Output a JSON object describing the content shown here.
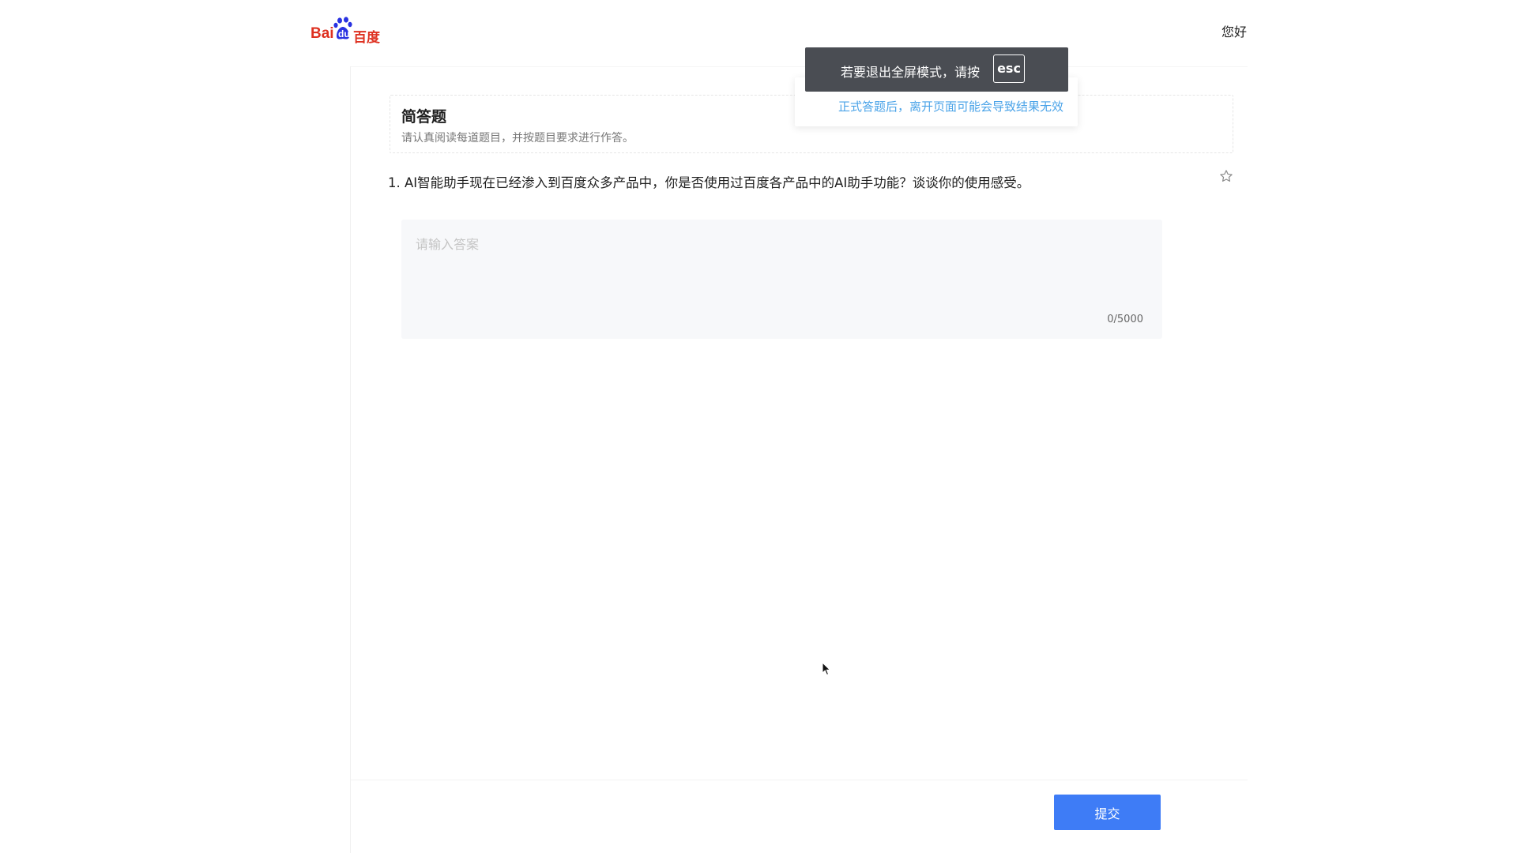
{
  "header": {
    "logo_text_left": "Bai",
    "logo_text_mid": "du",
    "logo_text_right": "百度",
    "greeting": "您好"
  },
  "fullscreen_toast": {
    "text": "若要退出全屏模式，请按",
    "key": "esc"
  },
  "warning": {
    "text": "正式答题后，离开页面可能会导致结果无效"
  },
  "section": {
    "title": "简答题",
    "description": "请认真阅读每道题目，并按题目要求进行作答。"
  },
  "question": {
    "text": "1. AI智能助手现在已经渗入到百度众多产品中，你是否使用过百度各产品中的AI助手功能？谈谈你的使用感受。"
  },
  "answer": {
    "placeholder": "请输入答案",
    "value": "",
    "counter": "0/5000"
  },
  "footer": {
    "submit_label": "提交"
  },
  "colors": {
    "primary": "#3e7cf6",
    "warning_text": "#4aa3e8",
    "toast_bg": "#4a4d53",
    "logo_red": "#de3121",
    "logo_blue": "#2932e1"
  }
}
